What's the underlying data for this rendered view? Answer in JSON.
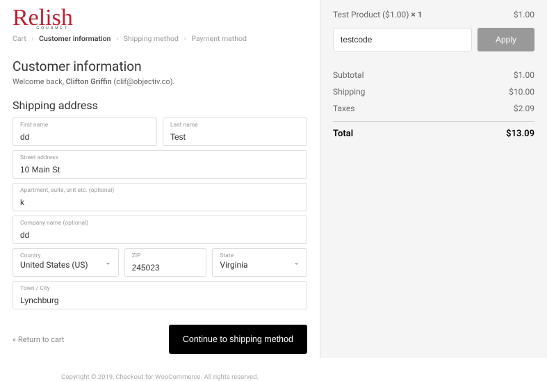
{
  "logo": {
    "text": "Relish",
    "sub": "GOURMET"
  },
  "breadcrumbs": {
    "cart": "Cart",
    "customer_info": "Customer information",
    "shipping_method": "Shipping method",
    "payment_method": "Payment method"
  },
  "heading": "Customer information",
  "welcome": {
    "prefix": "Welcome back, ",
    "name": "Clifton Griffin",
    "email_paren": " (clif@objectiv.co)."
  },
  "shipping_heading": "Shipping address",
  "fields": {
    "first_name": {
      "label": "First name",
      "value": "dd"
    },
    "last_name": {
      "label": "Last name",
      "value": "Test"
    },
    "street": {
      "label": "Street address",
      "value": "10 Main St"
    },
    "apt": {
      "label": "Apartment, suite, unit etc. (optional)",
      "value": "k"
    },
    "company": {
      "label": "Company name (optional)",
      "value": "dd"
    },
    "country": {
      "label": "Country",
      "value": "United States (US)"
    },
    "zip": {
      "label": "ZIP",
      "value": "245023"
    },
    "state": {
      "label": "State",
      "value": "Virginia"
    },
    "city": {
      "label": "Town / City",
      "value": "Lynchburg"
    }
  },
  "footer": {
    "return": "« Return to cart",
    "continue": "Continue to shipping method"
  },
  "copyright": "Copyright © 2019, Checkout for WooCommerce. All rights reserved.",
  "summary": {
    "product_name": "Test Product ($1.00) ",
    "product_qty": "× 1",
    "product_price": "$1.00",
    "coupon_value": "testcode",
    "apply": "Apply",
    "subtotal_label": "Subtotal",
    "subtotal": "$1.00",
    "shipping_label": "Shipping",
    "shipping": "$10.00",
    "taxes_label": "Taxes",
    "taxes": "$2.09",
    "total_label": "Total",
    "total": "$13.09"
  }
}
